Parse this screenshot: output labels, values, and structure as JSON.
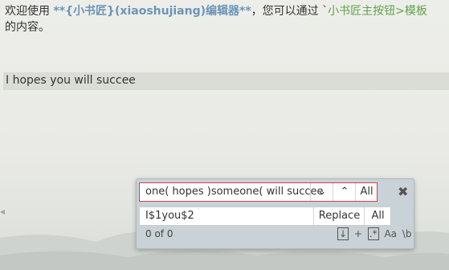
{
  "editor": {
    "line1_prefix": "欢迎使用 ",
    "line1_brand": "**{小书匠}(xiaoshujiang)编辑器**",
    "line1_mid": "，您可以通过 `",
    "line1_code": "小书匠主按钮>模板",
    "line2": "的内容。",
    "current_line": "I hopes you will succee"
  },
  "find": {
    "search_value": "one( hopes )someone( will succee",
    "next_icon": "chevron-down-icon",
    "prev_icon": "chevron-up-icon",
    "all_label": "All",
    "close_icon": "close-icon",
    "replace_value": "I$1you$2",
    "replace_label": "Replace",
    "replace_all_label": "All",
    "count": "0 of 0",
    "option_in_selection": "↓",
    "option_plus": "+",
    "option_regex": ".*",
    "option_case": "Aa",
    "option_word": "\\b"
  },
  "colors": {
    "accent_bold": "#6c95b9",
    "code_green": "#62a34f",
    "search_border": "#d23f4e"
  }
}
